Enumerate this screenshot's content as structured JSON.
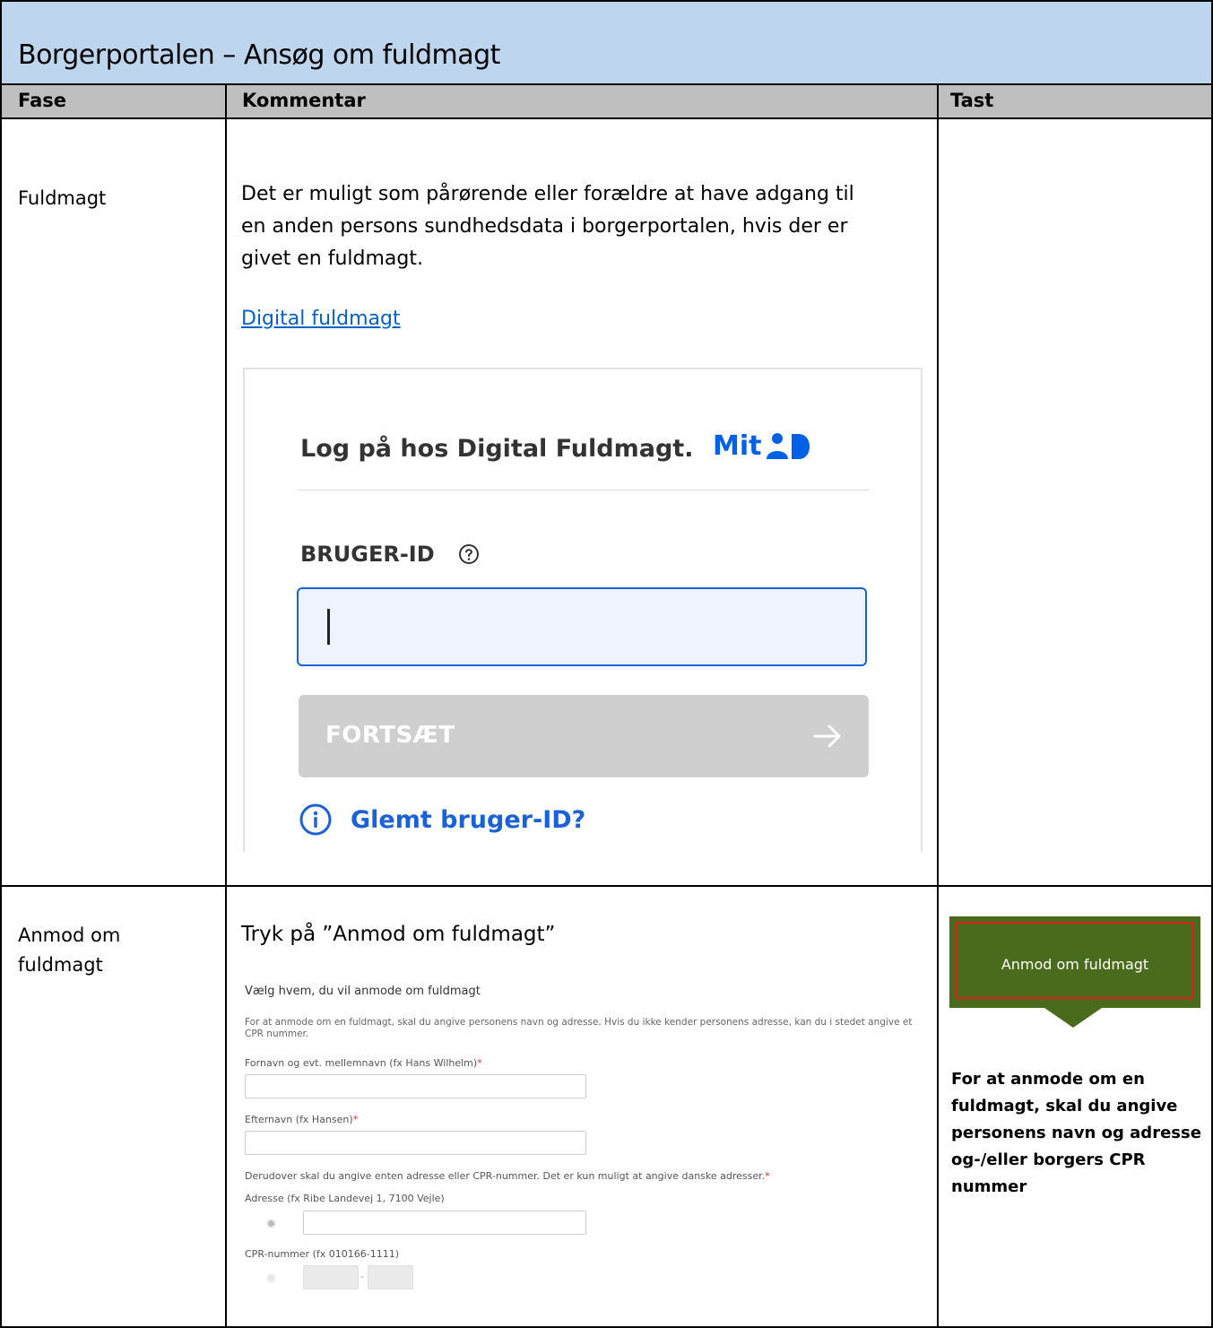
{
  "title": "Borgerportalen – Ansøg om fuldmagt",
  "columns": {
    "fase": "Fase",
    "kommentar": "Kommentar",
    "tast": "Tast"
  },
  "rows": [
    {
      "fase": "Fuldmagt",
      "comment": "Det er muligt som pårørende eller forældre at have adgang til en anden persons sundhedsdata i borgerportalen, hvis der er givet en fuldmagt.",
      "comment_lines": [
        "Det er muligt som pårørende eller forældre at have adgang til",
        "en anden persons sundhedsdata i borgerportalen, hvis der er",
        "givet en fuldmagt."
      ],
      "link": "Digital fuldmagt",
      "mitid": {
        "title": "Log på hos Digital Fuldmagt.",
        "logo_text": "Mit",
        "user_id_label": "BRUGER-ID",
        "user_id_value": "",
        "continue_label": "FORTSÆT",
        "forgot_label": "Glemt bruger-ID?",
        "accent_color": "#1a62d6"
      }
    },
    {
      "fase": "Anmod om fuldmagt",
      "fase_lines": [
        "Anmod om",
        "fuldmagt"
      ],
      "instruction": "Tryk på ”Anmod om fuldmagt”",
      "form": {
        "title": "Vælg hvem, du vil anmode om fuldmagt",
        "intro": "For at anmode om en fuldmagt, skal du angive personens navn og adresse. Hvis du ikke kender personens adresse, kan du i stedet angive et CPR nummer.",
        "first_name_label": "Fornavn og evt. mellemnavn (fx Hans Wilhelm)",
        "last_name_label": "Efternavn (fx Hansen)",
        "address_or_cpr_note": "Derudover skal du angive enten adresse eller CPR-nummer. Det er kun muligt at angive danske adresser.",
        "required_mark": "*",
        "address_label": "Adresse (fx Ribe Landevej 1, 7100 Vejle)",
        "cpr_label": "CPR-nummer (fx 010166-1111)",
        "cpr_separator": "-"
      },
      "tast": {
        "button_label": "Anmod om fuldmagt",
        "button_color": "#4b6b1c",
        "note_lines": [
          "For at anmode om en",
          "fuldmagt, skal du angive",
          "personens navn og adresse",
          "og-/eller borgers CPR",
          "nummer"
        ]
      }
    }
  ]
}
